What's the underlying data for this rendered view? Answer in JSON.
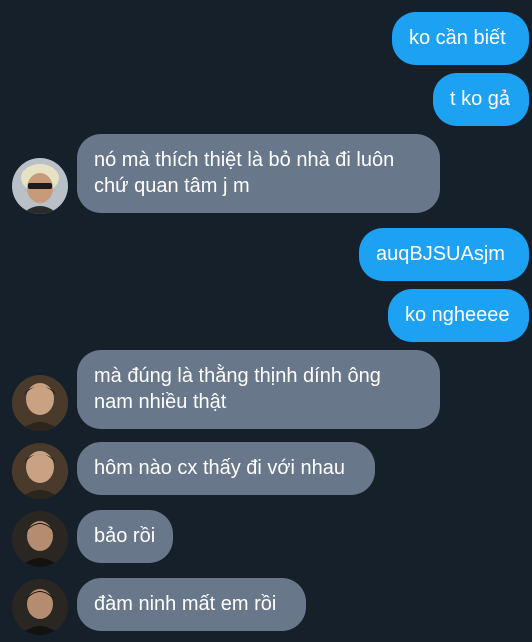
{
  "conversation": {
    "messages": [
      {
        "direction": "outgoing",
        "text": "ko cần biết"
      },
      {
        "direction": "outgoing",
        "text": "t ko gả"
      },
      {
        "direction": "incoming",
        "text": "nó mà thích thiệt là bỏ nhà đi luôn\nchứ quan tâm j m"
      },
      {
        "direction": "outgoing",
        "text": "auqBJSUAsjm"
      },
      {
        "direction": "outgoing",
        "text": "ko ngheeee"
      },
      {
        "direction": "incoming",
        "text": "mà đúng là thằng thịnh dính ông\nnam nhiều thật"
      },
      {
        "direction": "incoming",
        "text": "hôm nào cx thấy đi với nhau"
      },
      {
        "direction": "incoming",
        "text": "bảo rồi"
      },
      {
        "direction": "incoming",
        "text": "đàm ninh mất em rồi"
      }
    ]
  },
  "colors": {
    "background": "#16202b",
    "outgoing_bubble": "#1da1f2",
    "incoming_bubble": "#68788a",
    "text": "#ffffff"
  }
}
